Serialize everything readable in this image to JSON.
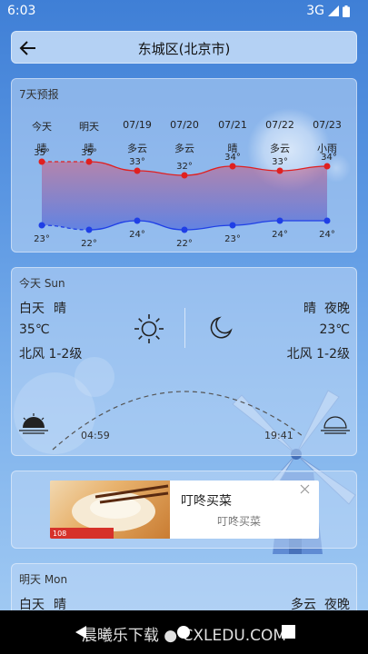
{
  "status": {
    "time": "6:03",
    "network": "3G"
  },
  "header": {
    "title": "东城区(北京市)"
  },
  "forecast": {
    "title": "7天预报",
    "days": [
      {
        "label": "今天",
        "weather": "晴",
        "high": "35°",
        "low": "23°"
      },
      {
        "label": "明天",
        "weather": "晴",
        "high": "35°",
        "low": "22°"
      },
      {
        "label": "07/19",
        "weather": "多云",
        "high": "33°",
        "low": "24°"
      },
      {
        "label": "07/20",
        "weather": "多云",
        "high": "32°",
        "low": "22°"
      },
      {
        "label": "07/21",
        "weather": "晴",
        "high": "34°",
        "low": "23°"
      },
      {
        "label": "07/22",
        "weather": "多云",
        "high": "33°",
        "low": "24°"
      },
      {
        "label": "07/23",
        "weather": "小雨",
        "high": "34°",
        "low": "24°"
      }
    ],
    "highs": [
      35,
      35,
      33,
      32,
      34,
      33,
      34
    ],
    "lows": [
      23,
      22,
      24,
      22,
      23,
      24,
      24
    ],
    "colors": {
      "high": "#e02020",
      "low": "#1f3fe6"
    }
  },
  "today": {
    "title": "今天  Sun",
    "day_label": "白天",
    "day_weather": "晴",
    "night_label": "夜晚",
    "night_weather": "晴",
    "day_temp": "35℃",
    "night_temp": "23℃",
    "day_wind": "北风  1-2级",
    "night_wind": "北风  1-2级",
    "sunrise": "04:59",
    "sunset": "19:41"
  },
  "ad": {
    "title": "叮咚买菜",
    "subtitle": "叮咚买菜"
  },
  "tomorrow": {
    "title": "明天  Mon",
    "day_label": "白天",
    "day_weather": "晴",
    "night_label": "夜晚",
    "night_weather": "多云"
  },
  "watermark": "晨曦乐下载 ● CXLEDU.COM"
}
